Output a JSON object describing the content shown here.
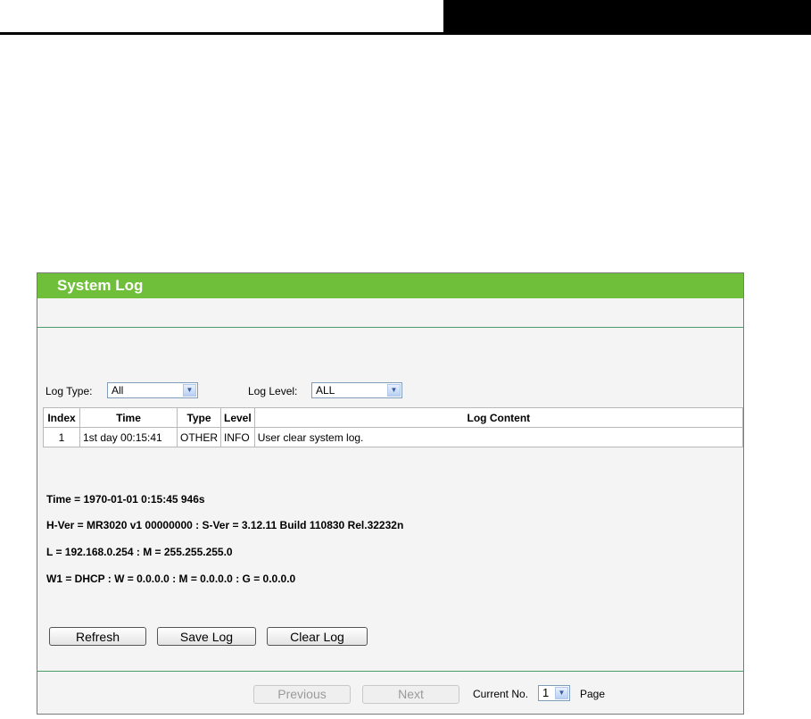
{
  "panel": {
    "title": "System Log"
  },
  "filters": {
    "log_type_label": "Log Type:",
    "log_type_value": "All",
    "log_level_label": "Log Level:",
    "log_level_value": "ALL"
  },
  "table": {
    "headers": [
      "Index",
      "Time",
      "Type",
      "Level",
      "Log Content"
    ],
    "rows": [
      [
        "1",
        "1st day 00:15:41",
        "OTHER",
        "INFO",
        "User clear system log."
      ]
    ]
  },
  "system_info": [
    "Time = 1970-01-01 0:15:45 946s",
    "H-Ver = MR3020 v1 00000000 : S-Ver = 3.12.11 Build 110830 Rel.32232n",
    "L = 192.168.0.254 : M = 255.255.255.0",
    "W1 = DHCP : W = 0.0.0.0 : M = 0.0.0.0 : G = 0.0.0.0"
  ],
  "buttons": {
    "refresh": "Refresh",
    "save_log": "Save Log",
    "clear_log": "Clear Log"
  },
  "pagination": {
    "previous": "Previous",
    "next": "Next",
    "current_label": "Current No.",
    "current_value": "1",
    "page_label": "Page"
  }
}
